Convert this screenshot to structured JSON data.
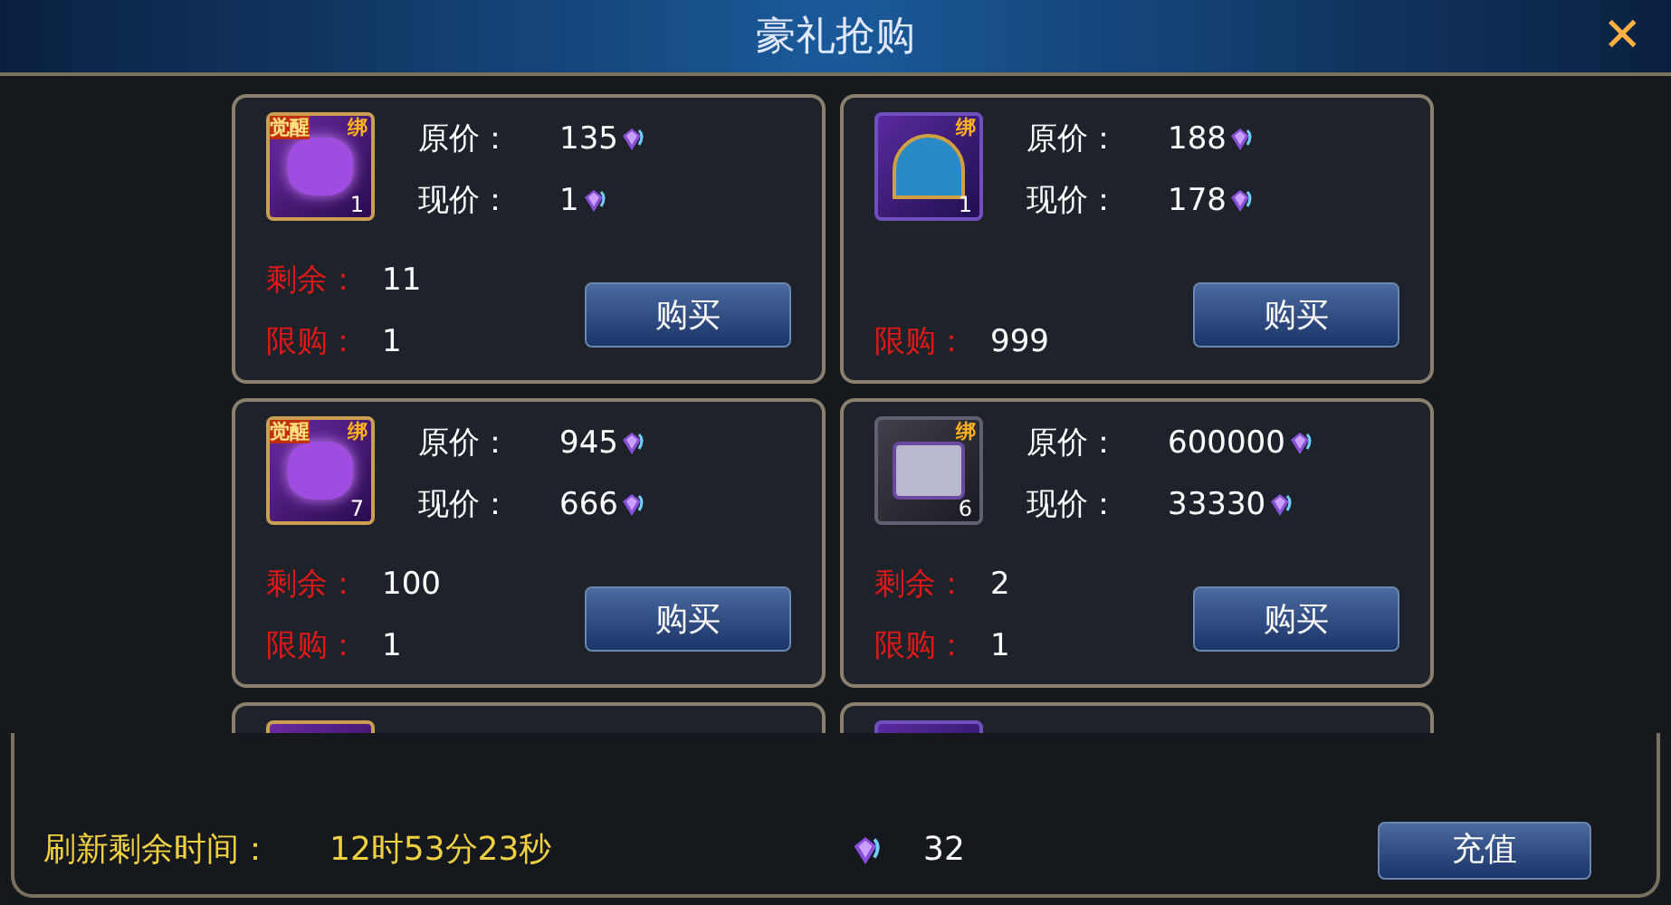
{
  "window": {
    "title": "豪礼抢购",
    "close": "✕"
  },
  "items": [
    {
      "kind": "gem",
      "badges": [
        "觉醒",
        "绑"
      ],
      "quantity": "1",
      "original_label": "原价：",
      "original_price": "135",
      "current_label": "现价：",
      "current_price": "1",
      "remaining_label": "剩余：",
      "remaining": "11",
      "limit_label": "限购：",
      "limit": "1",
      "button": "购买"
    },
    {
      "kind": "cloak",
      "badges": [
        "绑"
      ],
      "quantity": "1",
      "original_label": "原价：",
      "original_price": "188",
      "current_label": "现价：",
      "current_price": "178",
      "limit_label": "限购：",
      "limit": "999",
      "button": "购买"
    },
    {
      "kind": "gem",
      "badges": [
        "觉醒",
        "绑"
      ],
      "quantity": "7",
      "original_label": "原价：",
      "original_price": "945",
      "current_label": "现价：",
      "current_price": "666",
      "remaining_label": "剩余：",
      "remaining": "100",
      "limit_label": "限购：",
      "limit": "1",
      "button": "购买"
    },
    {
      "kind": "chest",
      "badges": [
        "绑"
      ],
      "quantity": "6",
      "original_label": "原价：",
      "original_price": "600000",
      "current_label": "现价：",
      "current_price": "33330",
      "remaining_label": "剩余：",
      "remaining": "2",
      "limit_label": "限购：",
      "limit": "1",
      "button": "购买"
    }
  ],
  "partial_items": [
    {
      "kind": "gem"
    },
    {
      "kind": "cloak"
    }
  ],
  "footer": {
    "refresh_label": "刷新剩余时间：",
    "refresh_time": "12时53分23秒",
    "balance": "32",
    "recharge_button": "充值"
  }
}
